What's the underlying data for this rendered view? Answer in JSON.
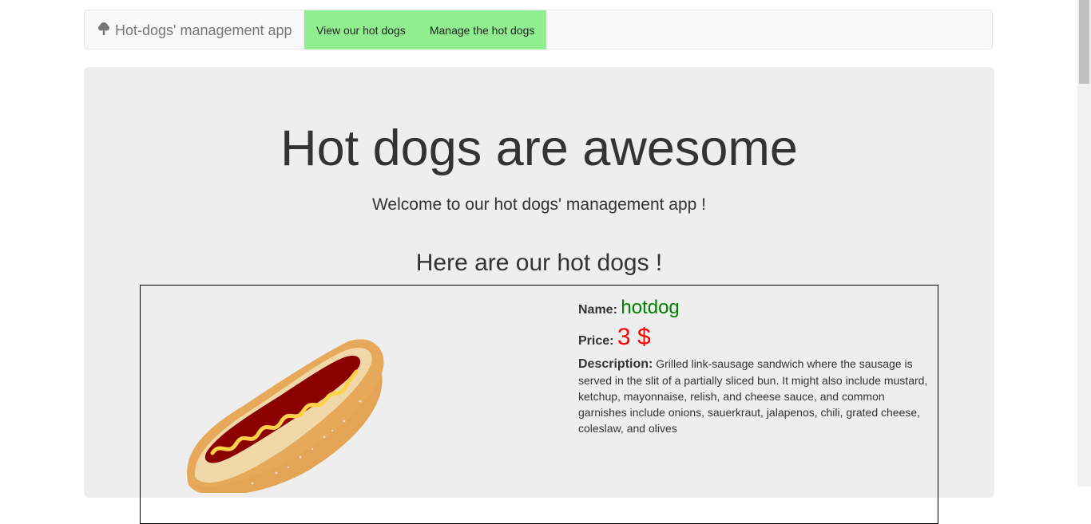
{
  "navbar": {
    "brand": "Hot-dogs' management app",
    "brand_icon": "tree-icon",
    "links": [
      "View our hot dogs",
      "Manage the hot dogs"
    ],
    "links_background": "#90ee90"
  },
  "hero": {
    "title": "Hot dogs are awesome",
    "subtitle": "Welcome to our hot dogs' management app !"
  },
  "section": {
    "title": "Here are our hot dogs !"
  },
  "hotdogs": [
    {
      "image": "hotdog-image",
      "name_label": "Name:",
      "name": "hotdog",
      "price_label": "Price:",
      "price": "3 $",
      "description_label": "Description:",
      "description": "Grilled link-sausage sandwich where the sausage is served in the slit of a partially sliced bun. It might also include mustard, ketchup, mayonnaise, relish, and cheese sauce, and common garnishes include onions, sauerkraut, jalapenos, chili, grated cheese, coleslaw, and olives"
    }
  ],
  "colors": {
    "name": "#008000",
    "price": "#ff0000",
    "jumbotron": "#eeeeee"
  }
}
